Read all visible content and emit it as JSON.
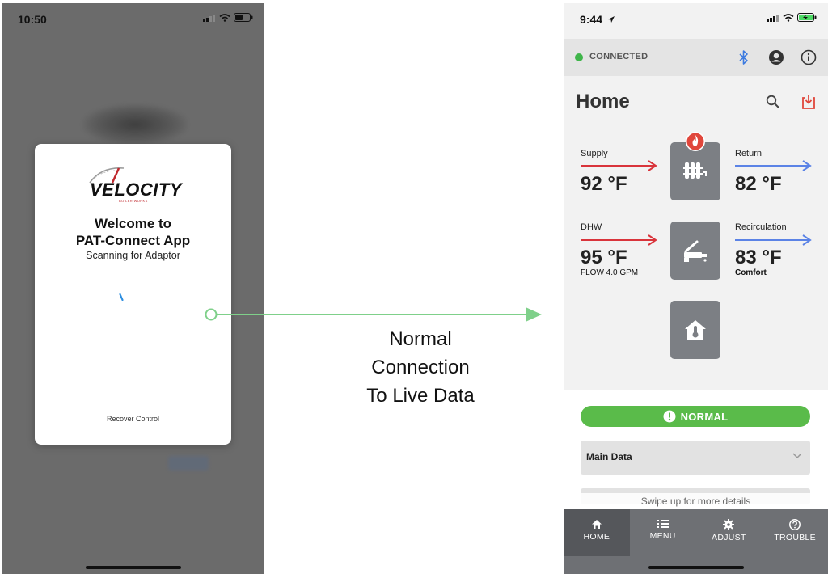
{
  "left_phone": {
    "time": "10:50",
    "modal": {
      "logo_text": "VELOCITY",
      "logo_subtext": "BOILER WORKS",
      "title_line1": "Welcome to",
      "title_line2": "PAT-Connect App",
      "subtitle": "Scanning for Adaptor",
      "recover_link": "Recover Control"
    }
  },
  "connector": {
    "caption_line1": "Normal",
    "caption_line2": "Connection",
    "caption_line3": "To Live Data",
    "color": "#7fd08a"
  },
  "right_phone": {
    "time": "9:44",
    "connection_status": "CONNECTED",
    "page_title": "Home",
    "supply": {
      "label": "Supply",
      "value": "92 °F"
    },
    "return": {
      "label": "Return",
      "value": "82 °F"
    },
    "dhw": {
      "label": "DHW",
      "value": "95 °F",
      "sub": "FLOW 4.0 GPM"
    },
    "recirculation": {
      "label": "Recirculation",
      "value": "83 °F",
      "sub": "Comfort"
    },
    "status_pill": "NORMAL",
    "main_data_label": "Main Data",
    "swipe_hint": "Swipe up for more details",
    "tabs": [
      {
        "label": "HOME",
        "icon": "home-icon"
      },
      {
        "label": "MENU",
        "icon": "list-icon"
      },
      {
        "label": "ADJUST",
        "icon": "gear-icon"
      },
      {
        "label": "TROUBLE",
        "icon": "help-icon"
      }
    ],
    "colors": {
      "hot": "#d9343b",
      "cold": "#5b83e6",
      "ok": "#5abb4a",
      "tile": "#7c7f84",
      "tabbar": "#6e7074"
    }
  }
}
